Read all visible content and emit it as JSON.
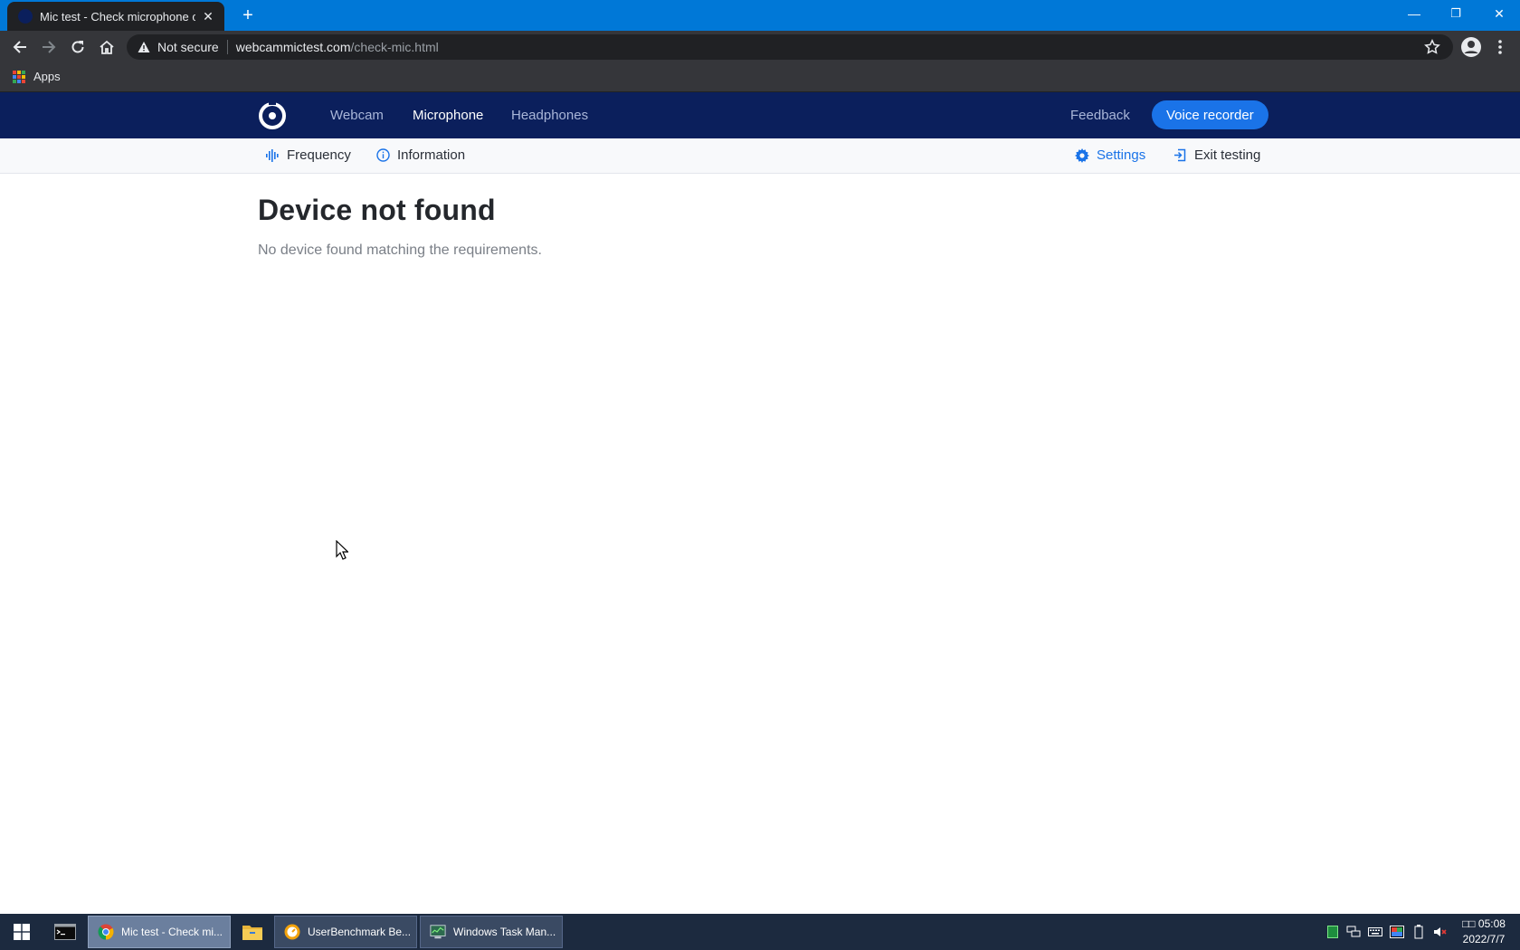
{
  "browser": {
    "tab_title": "Mic test - Check microphone online",
    "new_tab": "+",
    "controls": {
      "minimize": "—",
      "restore": "❐",
      "close": "✕"
    },
    "omnibox": {
      "security_label": "Not secure",
      "host": "webcammictest.com",
      "path": "/check-mic.html"
    },
    "bookmarks": {
      "apps_label": "Apps"
    }
  },
  "site": {
    "nav": {
      "webcam": "Webcam",
      "microphone": "Microphone",
      "headphones": "Headphones",
      "feedback": "Feedback",
      "voice_recorder": "Voice recorder"
    },
    "subbar": {
      "frequency": "Frequency",
      "information": "Information",
      "settings": "Settings",
      "exit_testing": "Exit testing"
    },
    "main": {
      "title": "Device not found",
      "description": "No device found matching the requirements."
    }
  },
  "taskbar": {
    "apps": [
      {
        "label": "Mic test - Check mi...",
        "active": true
      },
      {
        "label": "UserBenchmark Be...",
        "active": false
      },
      {
        "label": "Windows Task Man...",
        "active": false
      }
    ],
    "clock": {
      "time": "□□ 05:08",
      "date": "2022/7/7"
    }
  },
  "colors": {
    "titlebar": "#0078d7",
    "site_nav": "#0b1f5c",
    "accent": "#1a73e8"
  }
}
